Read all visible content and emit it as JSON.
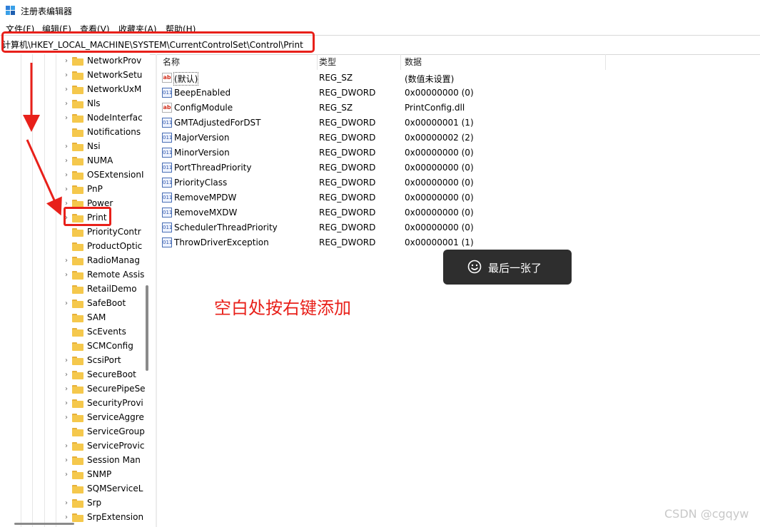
{
  "window": {
    "title": "注册表编辑器"
  },
  "menu": [
    {
      "label": "文件(F)"
    },
    {
      "label": "编辑(E)"
    },
    {
      "label": "查看(V)"
    },
    {
      "label": "收藏夹(A)"
    },
    {
      "label": "帮助(H)"
    }
  ],
  "address": {
    "path": "计算机\\HKEY_LOCAL_MACHINE\\SYSTEM\\CurrentControlSet\\Control\\Print"
  },
  "tree": {
    "items": [
      {
        "label": "NetworkProv",
        "expandable": true
      },
      {
        "label": "NetworkSetu",
        "expandable": true
      },
      {
        "label": "NetworkUxM",
        "expandable": true
      },
      {
        "label": "Nls",
        "expandable": true
      },
      {
        "label": "NodeInterfac",
        "expandable": true
      },
      {
        "label": "Notifications",
        "expandable": false
      },
      {
        "label": "Nsi",
        "expandable": true
      },
      {
        "label": "NUMA",
        "expandable": true
      },
      {
        "label": "OSExtensionI",
        "expandable": true
      },
      {
        "label": "PnP",
        "expandable": true
      },
      {
        "label": "Power",
        "expandable": true
      },
      {
        "label": "Print",
        "expandable": true,
        "selected": true
      },
      {
        "label": "PriorityContr",
        "expandable": false
      },
      {
        "label": "ProductOptic",
        "expandable": false
      },
      {
        "label": "RadioManag",
        "expandable": true
      },
      {
        "label": "Remote Assis",
        "expandable": true
      },
      {
        "label": "RetailDemo",
        "expandable": false
      },
      {
        "label": "SafeBoot",
        "expandable": true
      },
      {
        "label": "SAM",
        "expandable": false
      },
      {
        "label": "ScEvents",
        "expandable": false
      },
      {
        "label": "SCMConfig",
        "expandable": false
      },
      {
        "label": "ScsiPort",
        "expandable": true
      },
      {
        "label": "SecureBoot",
        "expandable": true
      },
      {
        "label": "SecurePipeSe",
        "expandable": true
      },
      {
        "label": "SecurityProvi",
        "expandable": true
      },
      {
        "label": "ServiceAggre",
        "expandable": true
      },
      {
        "label": "ServiceGroup",
        "expandable": false
      },
      {
        "label": "ServiceProvic",
        "expandable": true
      },
      {
        "label": "Session Man",
        "expandable": true
      },
      {
        "label": "SNMP",
        "expandable": true
      },
      {
        "label": "SQMServiceL",
        "expandable": false
      },
      {
        "label": "Srp",
        "expandable": true
      },
      {
        "label": "SrpExtension",
        "expandable": true
      }
    ]
  },
  "list": {
    "columns": [
      {
        "label": "名称"
      },
      {
        "label": "类型"
      },
      {
        "label": "数据"
      }
    ],
    "rows": [
      {
        "name": "(默认)",
        "type": "REG_SZ",
        "data": "(数值未设置)",
        "icon": "string-value-icon"
      },
      {
        "name": "BeepEnabled",
        "type": "REG_DWORD",
        "data": "0x00000000 (0)",
        "icon": "binary-value-icon"
      },
      {
        "name": "ConfigModule",
        "type": "REG_SZ",
        "data": "PrintConfig.dll",
        "icon": "string-value-icon"
      },
      {
        "name": "GMTAdjustedForDST",
        "type": "REG_DWORD",
        "data": "0x00000001 (1)",
        "icon": "binary-value-icon"
      },
      {
        "name": "MajorVersion",
        "type": "REG_DWORD",
        "data": "0x00000002 (2)",
        "icon": "binary-value-icon"
      },
      {
        "name": "MinorVersion",
        "type": "REG_DWORD",
        "data": "0x00000000 (0)",
        "icon": "binary-value-icon"
      },
      {
        "name": "PortThreadPriority",
        "type": "REG_DWORD",
        "data": "0x00000000 (0)",
        "icon": "binary-value-icon"
      },
      {
        "name": "PriorityClass",
        "type": "REG_DWORD",
        "data": "0x00000000 (0)",
        "icon": "binary-value-icon"
      },
      {
        "name": "RemoveMPDW",
        "type": "REG_DWORD",
        "data": "0x00000000 (0)",
        "icon": "binary-value-icon"
      },
      {
        "name": "RemoveMXDW",
        "type": "REG_DWORD",
        "data": "0x00000000 (0)",
        "icon": "binary-value-icon"
      },
      {
        "name": "SchedulerThreadPriority",
        "type": "REG_DWORD",
        "data": "0x00000000 (0)",
        "icon": "binary-value-icon"
      },
      {
        "name": "ThrowDriverException",
        "type": "REG_DWORD",
        "data": "0x00000001 (1)",
        "icon": "binary-value-icon"
      }
    ]
  },
  "annotation": {
    "text": "空白处按右键添加"
  },
  "toast": {
    "text": "最后一张了",
    "icon": "smiley-icon"
  },
  "watermark": {
    "text": "CSDN @cgqyw"
  },
  "colors": {
    "highlight_red": "#e8201a",
    "folder_yellow": "#f5c84c",
    "toast_bg": "#2e2e2e"
  }
}
